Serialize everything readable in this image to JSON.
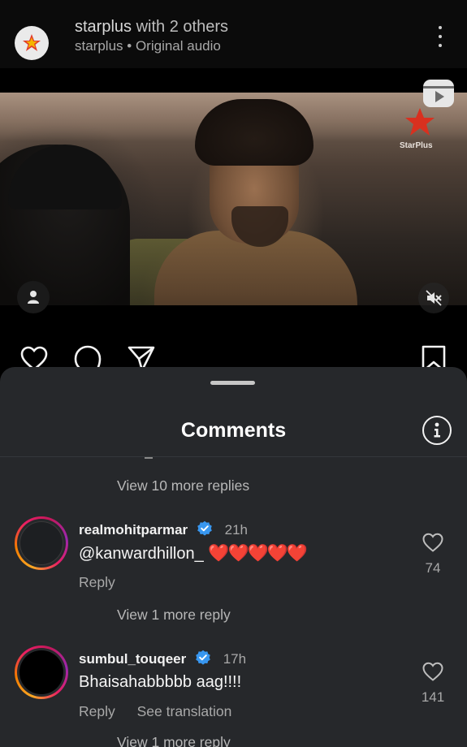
{
  "post": {
    "author": "starplus",
    "title_rest": "with 2 others",
    "subtitle_author": "starplus",
    "subtitle_separator": "•",
    "subtitle_audio": "Original audio"
  },
  "video": {
    "watermark_text": "StarPlus",
    "brand_logo_text": "StarPlus"
  },
  "sheet": {
    "title": "Comments",
    "view_more_top": "View 10 more replies",
    "view_more_middle": "View 1 more reply",
    "view_more_bottom": "View 1 more reply"
  },
  "comments": [
    {
      "username": "realmohitparmar",
      "verified": true,
      "time": "21h",
      "mention": "@kanwardhillon_",
      "emoji": "❤️❤️❤️❤️❤️",
      "reply_label": "Reply",
      "likes": "74"
    },
    {
      "username": "sumbul_touqeer",
      "verified": true,
      "time": "17h",
      "text": "Bhaisahabbbbb aag!!!!",
      "reply_label": "Reply",
      "translate_label": "See translation",
      "likes": "141"
    }
  ],
  "colors": {
    "sheet_bg": "#26282b",
    "accent_verified": "#3897f0",
    "heart_red": "#e0152f"
  }
}
